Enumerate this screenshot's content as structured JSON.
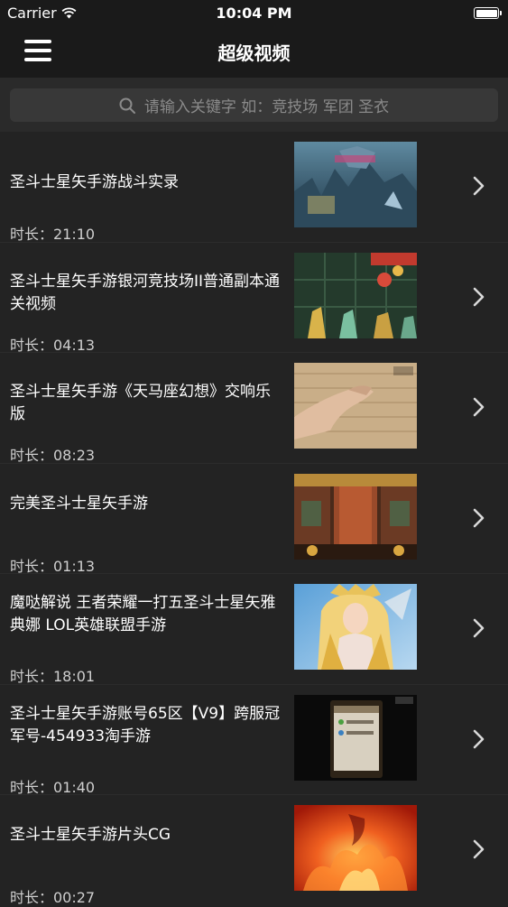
{
  "status_bar": {
    "carrier": "Carrier",
    "time": "10:04 PM"
  },
  "nav": {
    "title": "超级视频"
  },
  "search": {
    "placeholder": "请输入关键字 如：竞技场 军团 圣衣"
  },
  "videos": [
    {
      "title": "圣斗士星矢手游战斗实录",
      "duration": "时长：21:10",
      "thumb": "battle-scene"
    },
    {
      "title": "圣斗士星矢手游银河竞技场II普通副本通关视频",
      "duration": "时长：04:13",
      "thumb": "arena-scene"
    },
    {
      "title": "圣斗士星矢手游《天马座幻想》交响乐版",
      "duration": "时长：08:23",
      "thumb": "hand-instrument"
    },
    {
      "title": "完美圣斗士星矢手游",
      "duration": "时长：01:13",
      "thumb": "palace-scene"
    },
    {
      "title": "魔哒解说 王者荣耀一打五圣斗士星矢雅典娜 LOL英雄联盟手游",
      "duration": "时长：18:01",
      "thumb": "athena-art"
    },
    {
      "title": "圣斗士星矢手游账号65区【V9】跨服冠军号-454933淘手游",
      "duration": "时长：01:40",
      "thumb": "phone-screenshot"
    },
    {
      "title": "圣斗士星矢手游片头CG",
      "duration": "时长：00:27",
      "thumb": "fire-cg"
    }
  ]
}
